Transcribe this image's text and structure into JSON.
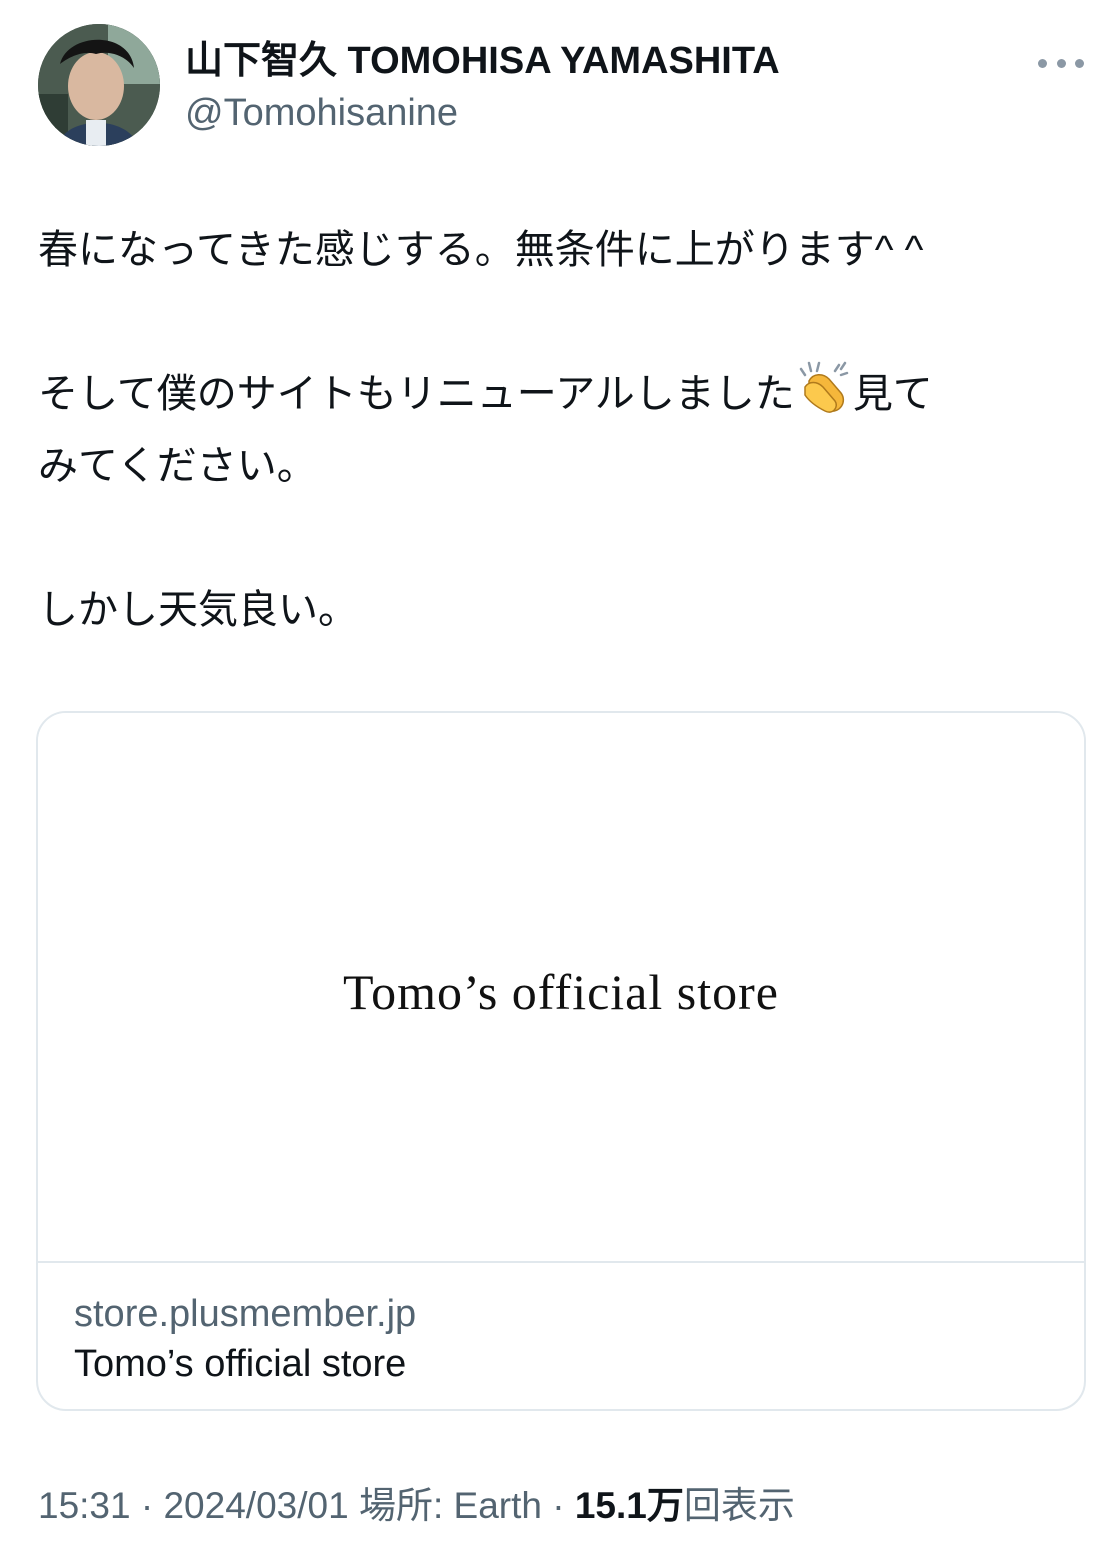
{
  "author": {
    "display_name": "山下智久 TOMOHISA YAMASHITA",
    "handle": "@Tomohisanine",
    "avatar_icon": "profile-photo"
  },
  "more_icon": "more-dots-icon",
  "tweet": {
    "line1": "春になってきた感じする。無条件に上がります^ ^",
    "line2_before_emoji": "そして僕のサイトもリニューアルしました",
    "emoji": "clapping-hands-icon",
    "line2_after_emoji": "見て",
    "line3": "みてください。",
    "line4": "しかし天気良い。"
  },
  "link_card": {
    "image_text": "Tomo’s official store",
    "domain": "store.plusmember.jp",
    "title": "Tomo’s official store"
  },
  "meta": {
    "time": "15:31",
    "separator1": " · ",
    "date": "2024/03/01",
    "location_label": " 場所: Earth",
    "separator2": " · ",
    "views_count": "15.1万",
    "views_label": "回表示"
  },
  "colors": {
    "text_primary": "#0f1419",
    "text_secondary": "#536471",
    "border": "#e1e8ed"
  }
}
